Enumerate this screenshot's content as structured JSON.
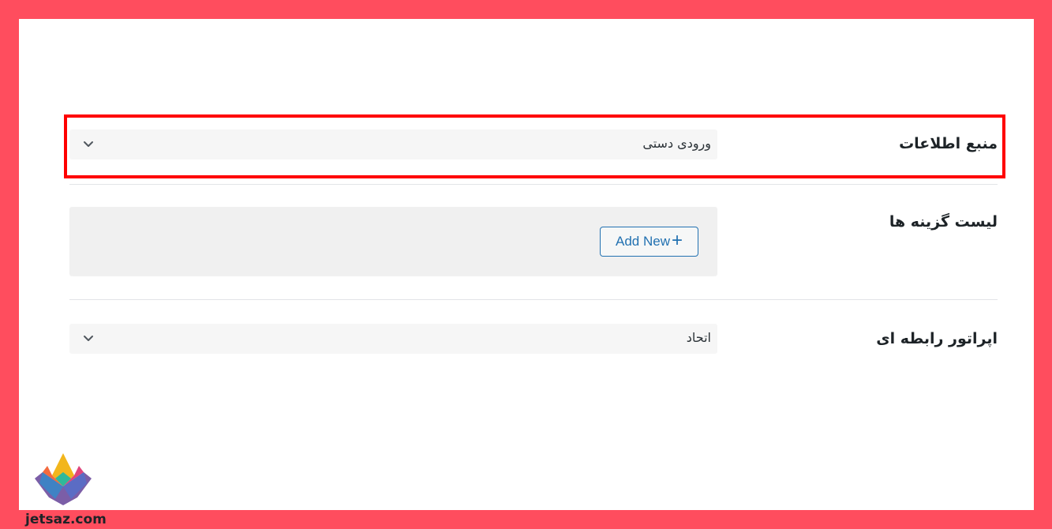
{
  "fields": {
    "data_source": {
      "label": "منبع اطلاعات",
      "value": "ورودی دستی"
    },
    "options_list": {
      "label": "لیست گزینه ها",
      "add_button_label": "Add New",
      "add_icon": "+"
    },
    "relational_operator": {
      "label": "اپراتور رابطه ای",
      "value": "اتحاد"
    }
  },
  "watermark": {
    "site": "jetsaz.com"
  },
  "colors": {
    "frame": "#ff4d5e",
    "highlight": "#ff0000",
    "accent": "#2271b1"
  }
}
